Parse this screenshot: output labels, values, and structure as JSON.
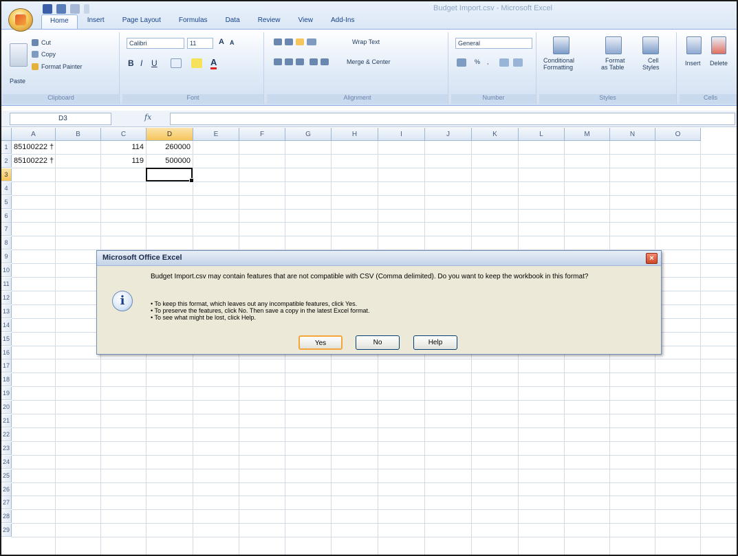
{
  "window": {
    "title": "Budget Import.csv - Microsoft Excel"
  },
  "ribbon": {
    "tabs": [
      "Home",
      "Insert",
      "Page Layout",
      "Formulas",
      "Data",
      "Review",
      "View",
      "Add-Ins"
    ],
    "active_tab": "Home",
    "clipboard": {
      "paste": "Paste",
      "cut": "Cut",
      "copy": "Copy",
      "format_painter": "Format Painter",
      "label": "Clipboard"
    },
    "font": {
      "name": "Calibri",
      "size": "11",
      "label": "Font"
    },
    "alignment": {
      "wrap_text": "Wrap Text",
      "merge_center": "Merge & Center",
      "label": "Alignment"
    },
    "number": {
      "format": "General",
      "label": "Number"
    },
    "styles": {
      "conditional": "Conditional",
      "conditional2": "Formatting",
      "format_table": "Format",
      "format_table2": "as Table",
      "cell_styles": "Cell",
      "cell_styles2": "Styles",
      "label": "Styles"
    },
    "cells": {
      "insert": "Insert",
      "delete": "Delete",
      "label": "Cells"
    }
  },
  "formula_bar": {
    "name_box": "D3",
    "fx": "fx",
    "value": ""
  },
  "sheet": {
    "columns": [
      "A",
      "B",
      "C",
      "D",
      "E",
      "F",
      "G",
      "H",
      "I",
      "J",
      "K",
      "L",
      "M",
      "N",
      "O"
    ],
    "selected_column": "D",
    "rows": [
      "1",
      "2",
      "3",
      "4",
      "5",
      "6",
      "7",
      "8",
      "9",
      "10",
      "11",
      "12",
      "13",
      "14",
      "15",
      "16",
      "17",
      "18",
      "19",
      "20",
      "21",
      "22",
      "23",
      "24",
      "25",
      "26",
      "27",
      "28",
      "29"
    ],
    "selected_row": "3",
    "cells": {
      "A1": "85100222 †",
      "C1": "114",
      "D1": "260000",
      "A2": "85100222 †",
      "C2": "119",
      "D2": "500000"
    }
  },
  "dialog": {
    "title": "Microsoft Office Excel",
    "close": "×",
    "icon": "info-icon",
    "message": "Budget Import.csv may contain features that are not compatible with CSV (Comma delimited).  Do you want to keep the workbook in this format?",
    "bullets": [
      "• To keep this format, which leaves out any incompatible features, click Yes.",
      "• To preserve the features, click No. Then save a copy in the latest Excel format.",
      "• To see what might be lost, click Help."
    ],
    "buttons": {
      "yes": "Yes",
      "no": "No",
      "help": "Help"
    }
  }
}
